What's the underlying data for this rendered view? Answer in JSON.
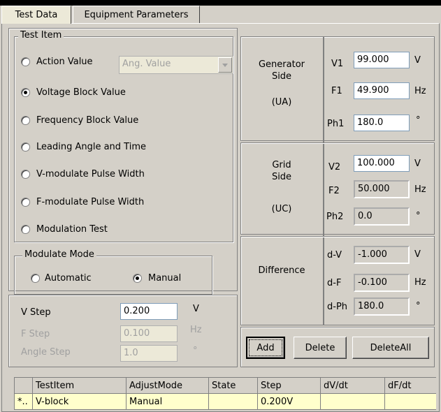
{
  "tabs": [
    "Test Data",
    "Equipment Parameters"
  ],
  "test_item": {
    "legend": "Test Item",
    "options": [
      "Action Value",
      "Voltage Block Value",
      "Frequency Block Value",
      "Leading Angle and Time",
      "V-modulate Pulse Width",
      "F-modulate Pulse Width",
      "Modulation Test"
    ],
    "selected": "Voltage Block Value",
    "angle_combo_value": "Ang. Value"
  },
  "modulate_mode": {
    "legend": "Modulate Mode",
    "options": [
      "Automatic",
      "Manual"
    ],
    "selected": "Manual"
  },
  "steps": {
    "v_label": "V Step",
    "v_value": "0.200",
    "v_unit": "V",
    "f_label": "F Step",
    "f_value": "0.100",
    "f_unit": "Hz",
    "a_label": "Angle Step",
    "a_value": "1.0",
    "a_unit": "°"
  },
  "generator": {
    "title": "Generator\nSide",
    "code": "(UA)",
    "v_label": "V1",
    "v_value": "99.000",
    "v_unit": "V",
    "f_label": "F1",
    "f_value": "49.900",
    "f_unit": "Hz",
    "ph_label": "Ph1",
    "ph_value": "180.0",
    "ph_unit": "°"
  },
  "grid": {
    "title": "Grid\nSide",
    "code": "(UC)",
    "v_label": "V2",
    "v_value": "100.000",
    "v_unit": "V",
    "f_label": "F2",
    "f_value": "50.000",
    "f_unit": "Hz",
    "ph_label": "Ph2",
    "ph_value": "0.0",
    "ph_unit": "°"
  },
  "difference": {
    "title": "Difference",
    "v_label": "d-V",
    "v_value": "-1.000",
    "v_unit": "V",
    "f_label": "d-F",
    "f_value": "-0.100",
    "f_unit": "Hz",
    "ph_label": "d-Ph",
    "ph_value": "180.0",
    "ph_unit": "°"
  },
  "buttons": {
    "add": "Add",
    "delete": "Delete",
    "delete_all": "DeleteAll"
  },
  "table": {
    "columns": [
      "",
      "TestItem",
      "AdjustMode",
      "State",
      "Step",
      "dV/dt",
      "dF/dt"
    ],
    "rows": [
      [
        "*..",
        "V-block",
        "Manual",
        "",
        "0.200V",
        "",
        ""
      ]
    ]
  }
}
